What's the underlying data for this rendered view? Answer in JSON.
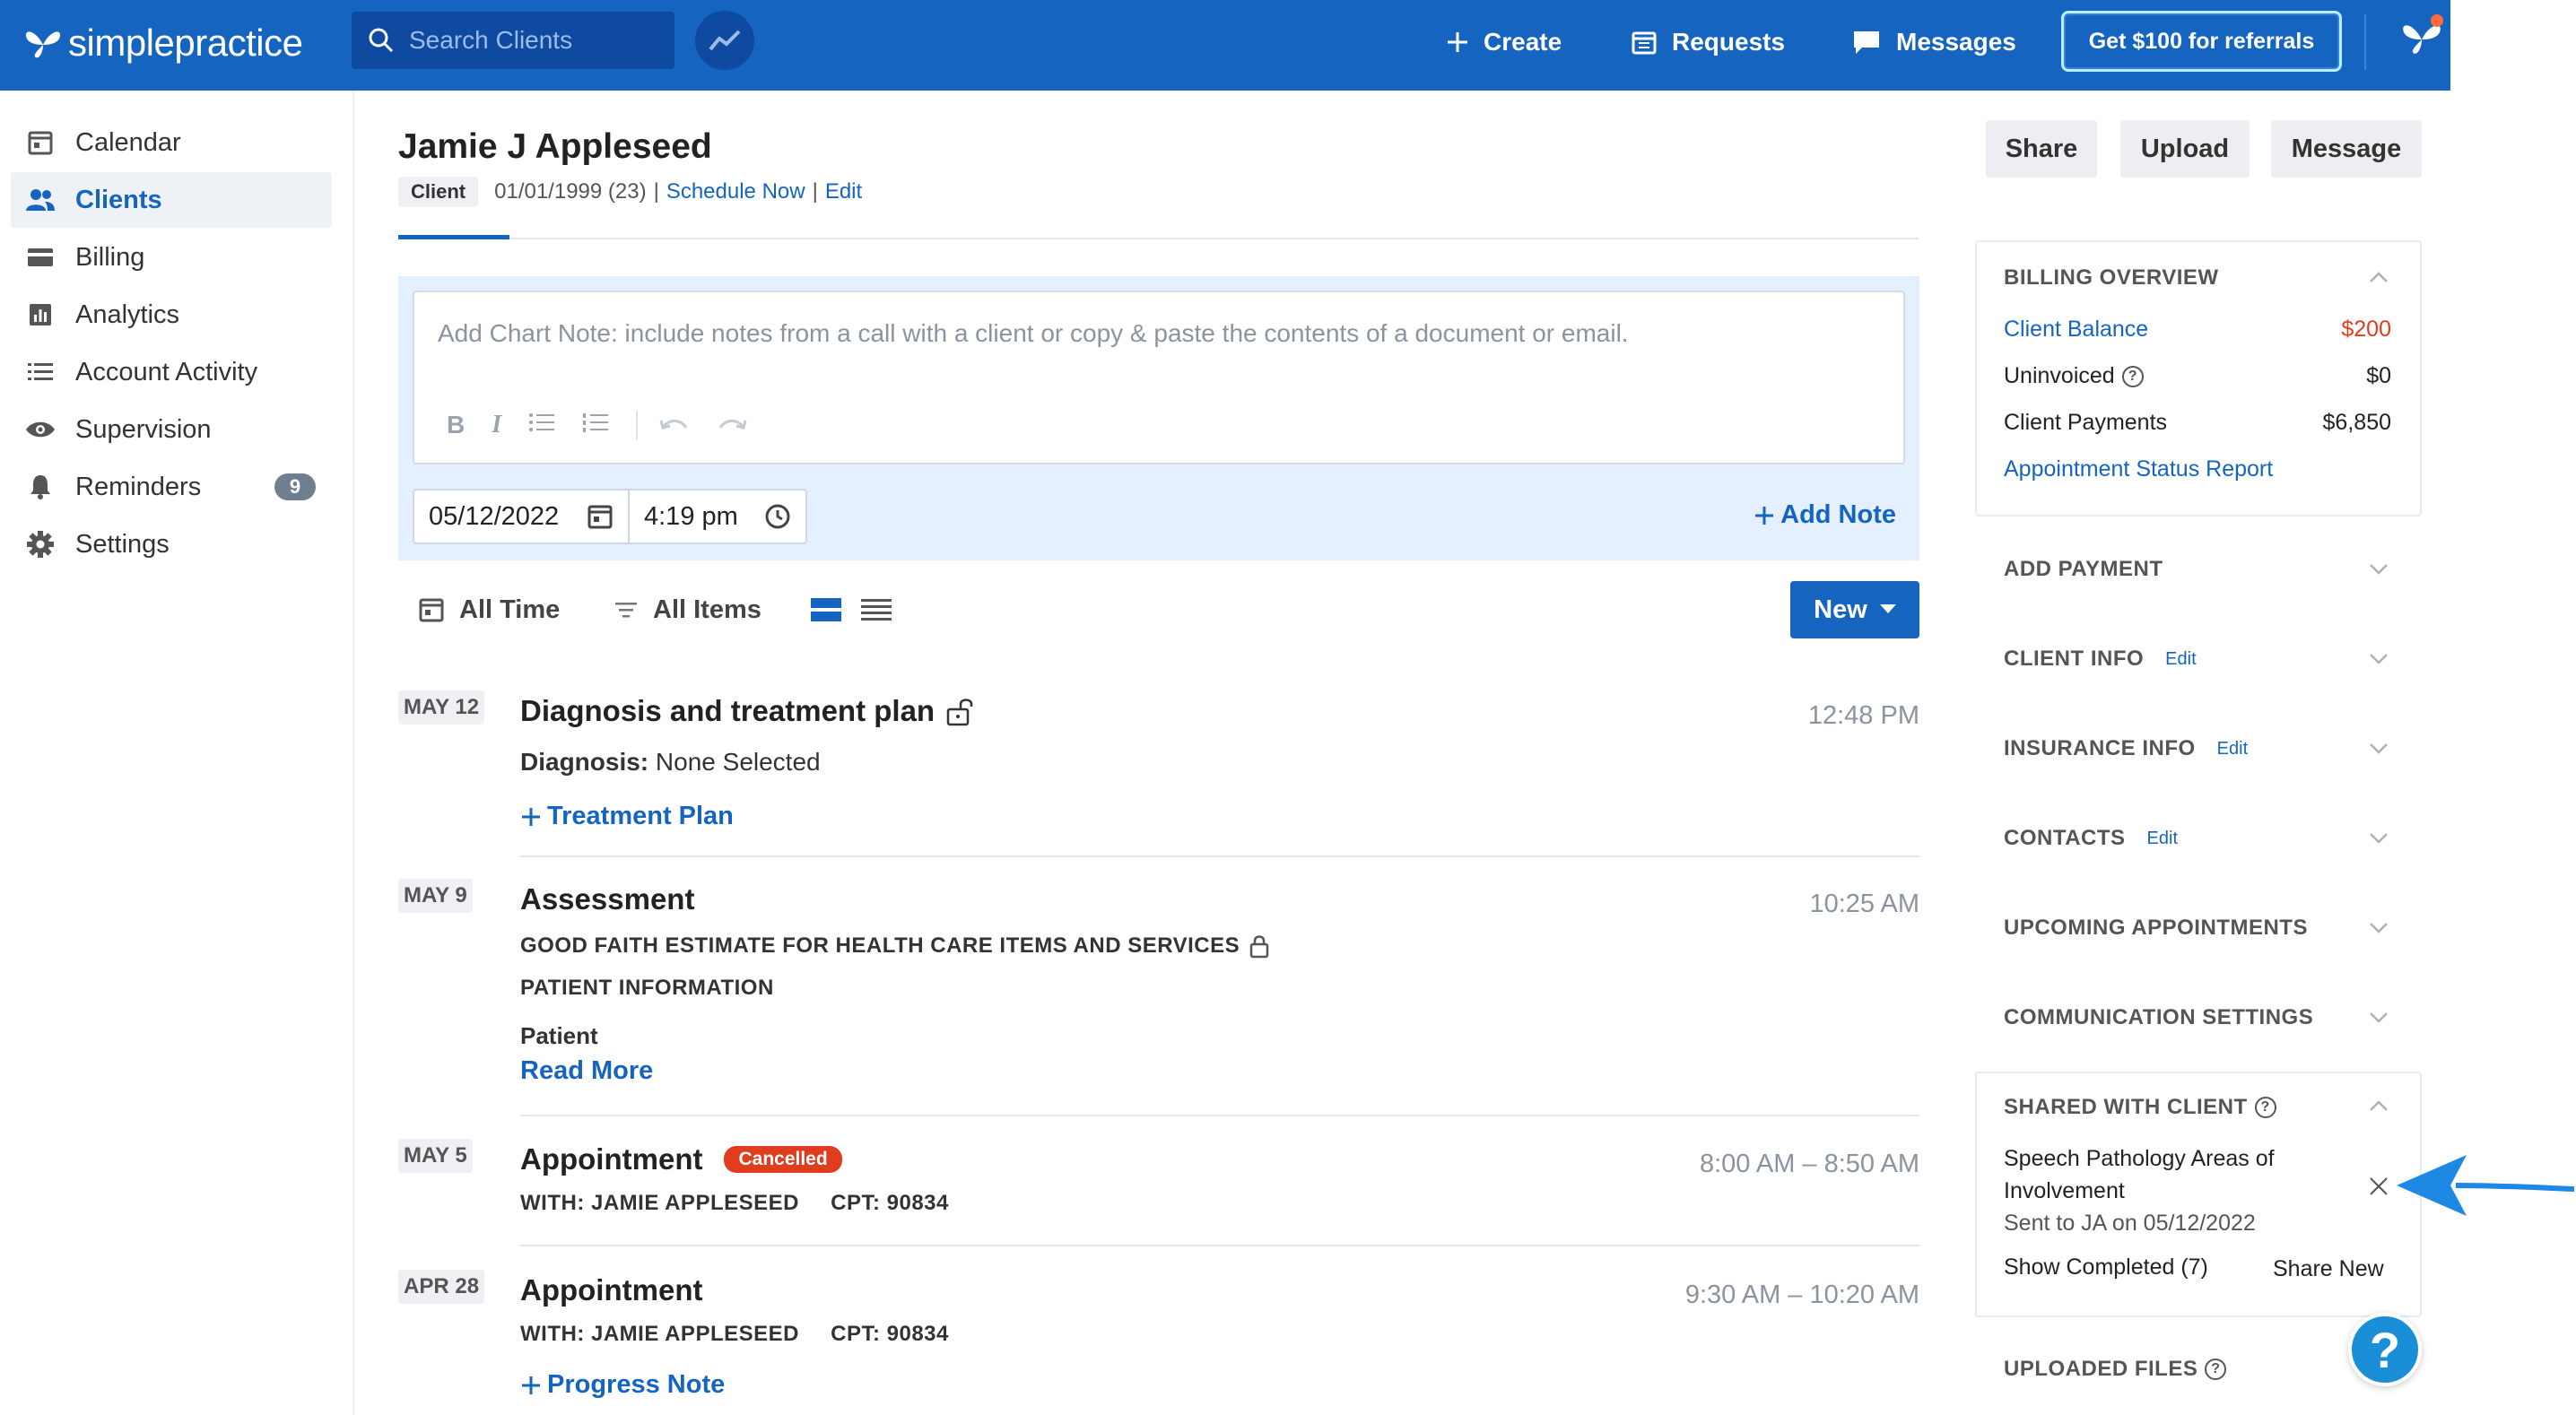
{
  "topbar": {
    "brand": "simplepractice",
    "search_placeholder": "Search Clients",
    "create_label": "Create",
    "requests_label": "Requests",
    "messages_label": "Messages",
    "referral_label": "Get $100 for referrals"
  },
  "sidebar": {
    "items": [
      {
        "label": "Calendar"
      },
      {
        "label": "Clients"
      },
      {
        "label": "Billing"
      },
      {
        "label": "Analytics"
      },
      {
        "label": "Account Activity"
      },
      {
        "label": "Supervision"
      },
      {
        "label": "Reminders",
        "badge": "9"
      },
      {
        "label": "Settings"
      }
    ]
  },
  "client": {
    "name": "Jamie J Appleseed",
    "chip": "Client",
    "dob": "01/01/1999 (23)",
    "separator": "|",
    "schedule_link": "Schedule Now",
    "edit_link": "Edit"
  },
  "header_buttons": {
    "share": "Share",
    "upload": "Upload",
    "message": "Message"
  },
  "note_editor": {
    "placeholder": "Add Chart Note: include notes from a call with a client or copy & paste the contents of a document or email.",
    "date": "05/12/2022",
    "time": "4:19 pm",
    "add_note": "Add Note"
  },
  "filters": {
    "time": "All Time",
    "items": "All Items",
    "new_button": "New"
  },
  "feed": [
    {
      "date": "MAY 12",
      "title": "Diagnosis and treatment plan",
      "time": "12:48 PM",
      "diagnosis_label": "Diagnosis:",
      "diagnosis_value": "None Selected",
      "action": "Treatment Plan"
    },
    {
      "date": "MAY 9",
      "title": "Assessment",
      "time": "10:25 AM",
      "line1": "GOOD FAITH ESTIMATE FOR HEALTH CARE ITEMS AND SERVICES",
      "line2": "PATIENT INFORMATION",
      "line3": "Patient",
      "action": "Read More"
    },
    {
      "date": "MAY 5",
      "title": "Appointment",
      "badge": "Cancelled",
      "time": "8:00 AM – 8:50 AM",
      "with": "WITH: JAMIE APPLESEED",
      "cpt": "CPT: 90834"
    },
    {
      "date": "APR 28",
      "title": "Appointment",
      "time": "9:30 AM – 10:20 AM",
      "with": "WITH: JAMIE APPLESEED",
      "cpt": "CPT: 90834",
      "action": "Progress Note"
    }
  ],
  "right_panel": {
    "billing": {
      "title": "BILLING OVERVIEW",
      "client_balance_label": "Client Balance",
      "client_balance_value": "$200",
      "uninvoiced_label": "Uninvoiced",
      "uninvoiced_value": "$0",
      "payments_label": "Client Payments",
      "payments_value": "$6,850",
      "report_link": "Appointment Status Report"
    },
    "sections": {
      "add_payment": "ADD PAYMENT",
      "client_info": "CLIENT INFO",
      "insurance_info": "INSURANCE INFO",
      "contacts": "CONTACTS",
      "upcoming": "UPCOMING APPOINTMENTS",
      "communication": "COMMUNICATION SETTINGS",
      "uploaded_files": "UPLOADED FILES",
      "edit": "Edit"
    },
    "shared": {
      "title": "SHARED WITH CLIENT",
      "doc_line1": "Speech Pathology Areas of",
      "doc_line2": "Involvement",
      "sent": "Sent to JA on 05/12/2022",
      "show_completed": "Show Completed (7)",
      "share_new": "Share New"
    }
  },
  "help_fab": "?",
  "colors": {
    "brand": "#1565c0",
    "danger": "#e03d1f",
    "arrow": "#1e88e5"
  }
}
